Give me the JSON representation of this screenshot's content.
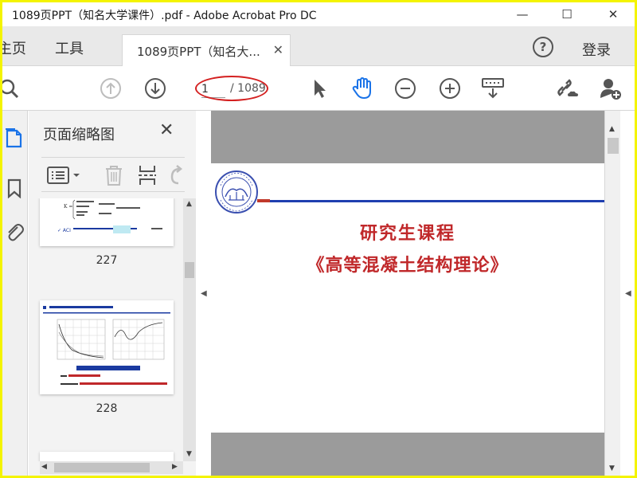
{
  "window": {
    "title": "1089页PPT（知名大学课件）.pdf - Adobe Acrobat Pro DC",
    "minimize": "—",
    "maximize": "☐",
    "close": "✕"
  },
  "tabs": {
    "home": "主页",
    "tools": "工具",
    "doc_tab_label": "1089页PPT（知名大...",
    "doc_tab_close": "✕",
    "help": "?",
    "login": "登录"
  },
  "toolbar": {
    "page_current": "1",
    "page_total": "/ 1089"
  },
  "panel": {
    "title": "页面缩略图",
    "close": "✕",
    "thumbs": [
      {
        "number": "227"
      },
      {
        "number": "228"
      }
    ]
  },
  "document": {
    "title_line1": "研究生课程",
    "title_line2": "《高等混凝土结构理论》"
  },
  "colors": {
    "frame_border": "#f4f400",
    "accent_blue": "#1a73e8",
    "slide_red": "#c0282a",
    "slide_blue_rule": "#1f3fb0",
    "annotation_red": "#d42020"
  }
}
